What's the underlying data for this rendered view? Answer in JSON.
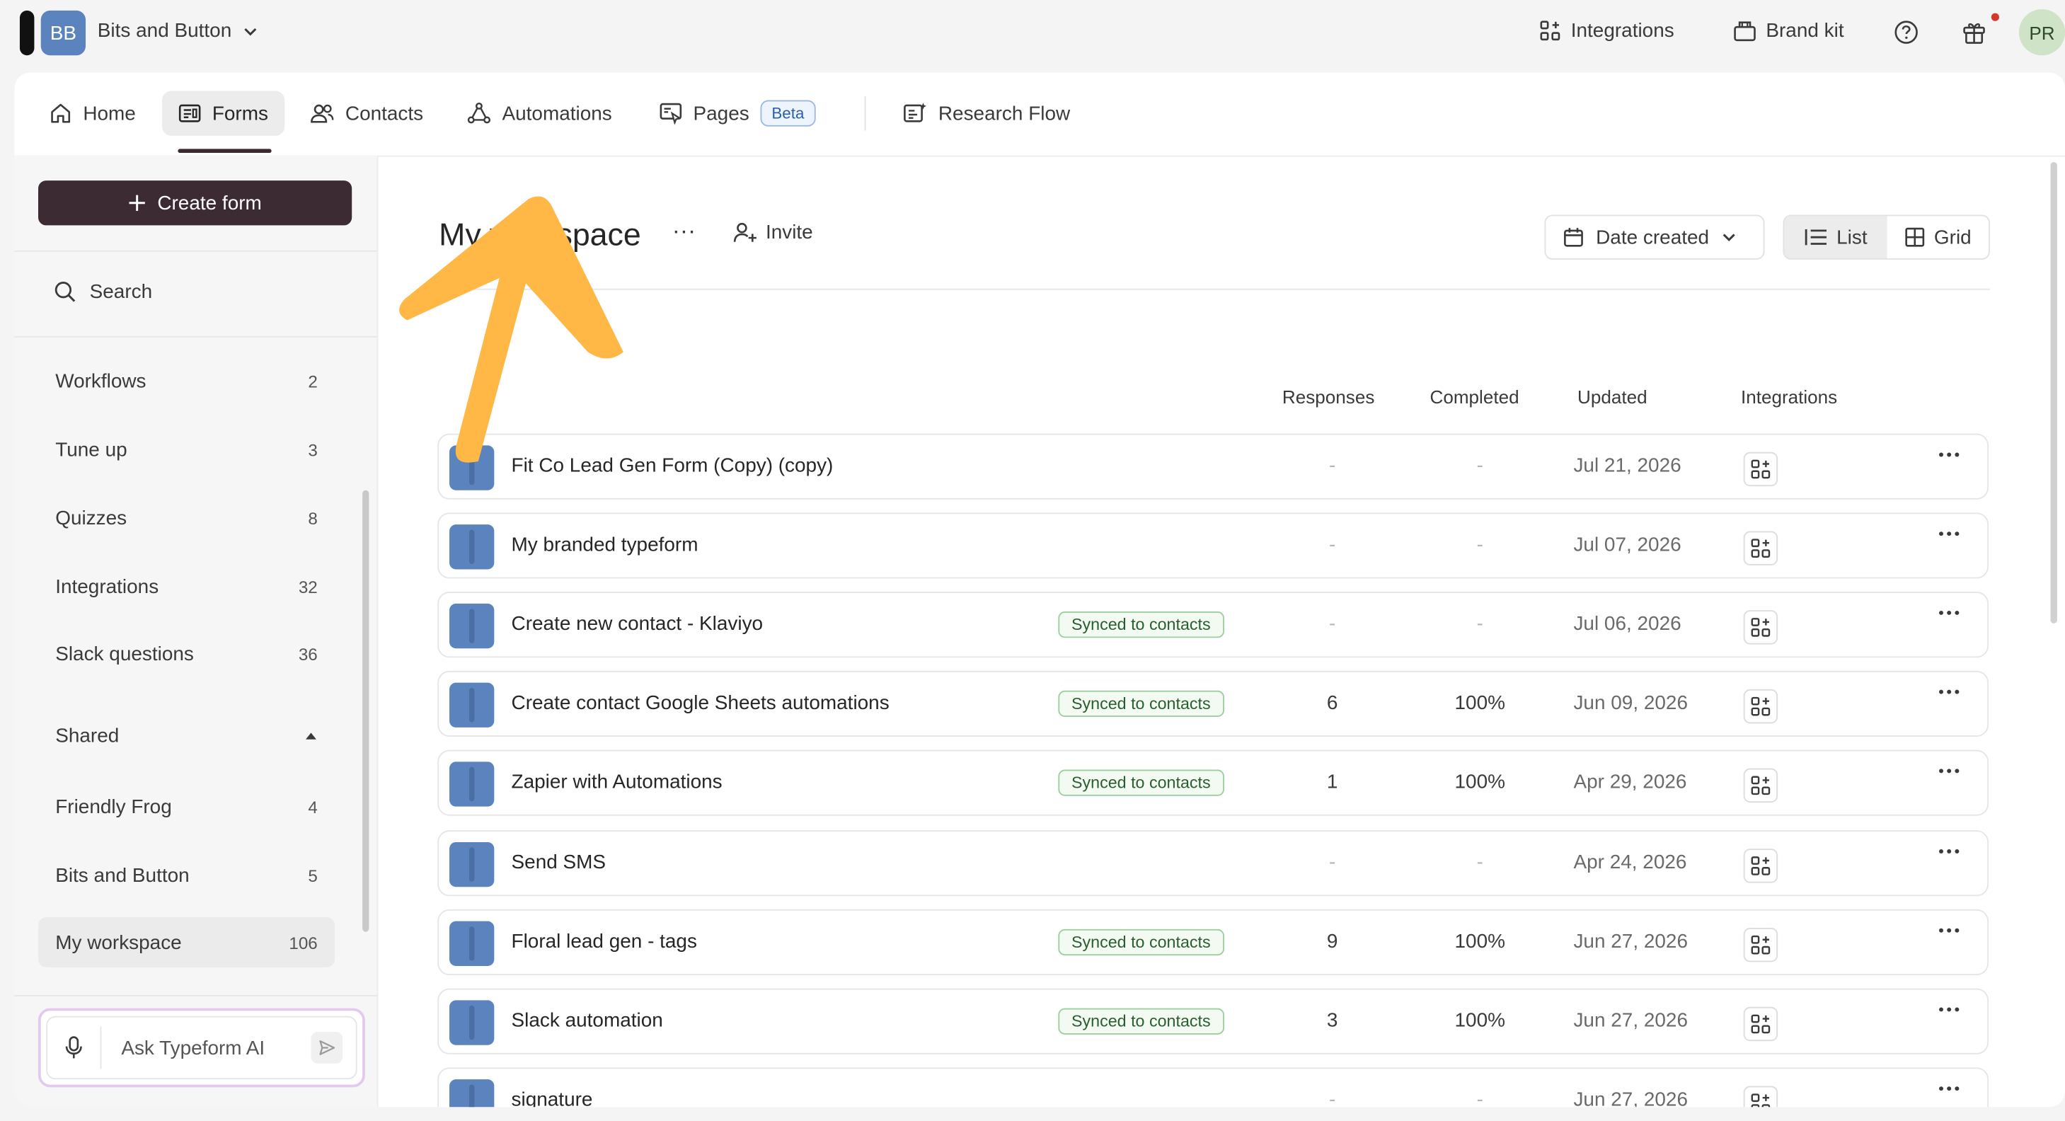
{
  "topbar": {
    "workspace_initials": "BB",
    "workspace_name": "Bits and Button",
    "integrations_label": "Integrations",
    "brand_kit_label": "Brand kit",
    "user_initials": "PR"
  },
  "nav": {
    "home": "Home",
    "forms": "Forms",
    "contacts": "Contacts",
    "automations": "Automations",
    "pages": "Pages",
    "pages_badge": "Beta",
    "research_flow": "Research Flow"
  },
  "sidebar": {
    "create_form": "Create form",
    "search": "Search",
    "items": [
      {
        "label": "Workflows",
        "count": "2"
      },
      {
        "label": "Tune up",
        "count": "3"
      },
      {
        "label": "Quizzes",
        "count": "8"
      },
      {
        "label": "Integrations",
        "count": "32"
      },
      {
        "label": "Slack questions",
        "count": "36"
      }
    ],
    "shared_label": "Shared",
    "shared_items": [
      {
        "label": "Friendly Frog",
        "count": "4"
      },
      {
        "label": "Bits and Button",
        "count": "5"
      },
      {
        "label": "My workspace",
        "count": "106"
      }
    ],
    "ai_placeholder": "Ask Typeform AI"
  },
  "content": {
    "workspace_title": "My workspace",
    "more_label": "···",
    "invite_label": "Invite",
    "sort_label": "Date created",
    "view_list": "List",
    "view_grid": "Grid",
    "columns": {
      "responses": "Responses",
      "completed": "Completed",
      "updated": "Updated",
      "integrations": "Integrations"
    },
    "forms": [
      {
        "name": "Fit Co Lead Gen Form (Copy) (copy)",
        "badge": "",
        "responses": "-",
        "completed": "-",
        "updated": "Jul 21, 2026"
      },
      {
        "name": "My branded typeform",
        "badge": "",
        "responses": "-",
        "completed": "-",
        "updated": "Jul 07, 2026"
      },
      {
        "name": "Create new contact - Klaviyo",
        "badge": "Synced to contacts",
        "responses": "-",
        "completed": "-",
        "updated": "Jul 06, 2026"
      },
      {
        "name": "Create contact Google Sheets automations",
        "badge": "Synced to contacts",
        "responses": "6",
        "completed": "100%",
        "updated": "Jun 09, 2026"
      },
      {
        "name": "Zapier with Automations",
        "badge": "Synced to contacts",
        "responses": "1",
        "completed": "100%",
        "updated": "Apr 29, 2026"
      },
      {
        "name": "Send SMS",
        "badge": "",
        "responses": "-",
        "completed": "-",
        "updated": "Apr 24, 2026"
      },
      {
        "name": "Floral lead gen - tags",
        "badge": "Synced to contacts",
        "responses": "9",
        "completed": "100%",
        "updated": "Jun 27, 2026"
      },
      {
        "name": "Slack automation",
        "badge": "Synced to contacts",
        "responses": "3",
        "completed": "100%",
        "updated": "Jun 27, 2026"
      },
      {
        "name": "signature",
        "badge": "",
        "responses": "-",
        "completed": "-",
        "updated": "Jun 27, 2026"
      }
    ]
  },
  "colors": {
    "accent_dark": "#3d2b33",
    "thumb_blue": "#5b83bd",
    "annotation_arrow": "#ffb845",
    "badge_green": "#2b5e2e"
  }
}
